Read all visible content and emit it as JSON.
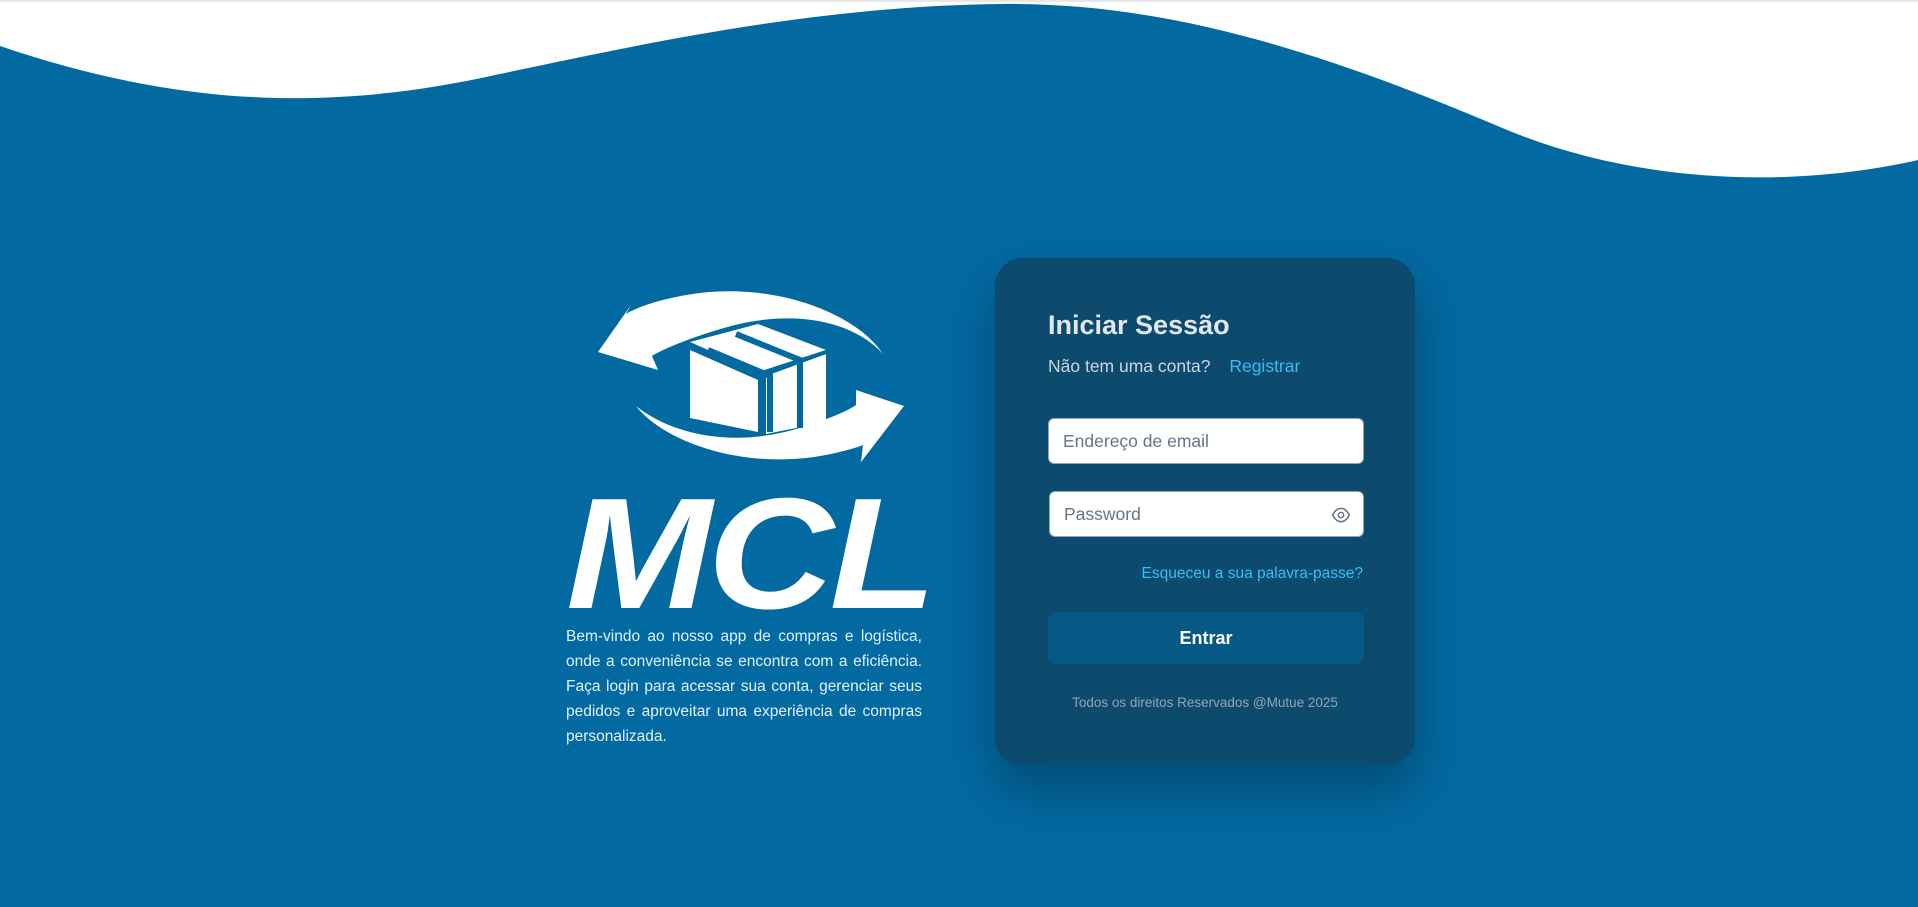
{
  "colors": {
    "background": "#0369a1",
    "card": "#0c4a6e",
    "button": "#075985",
    "link": "#38bdf8",
    "wave": "#ffffff"
  },
  "brand": {
    "logo_text": "MCL",
    "logo_icon": "box-with-circular-arrows-icon",
    "welcome_text": "Bem-vindo ao nosso app de compras e logística, onde a conveniência se encontra com a eficiência. Faça login para acessar sua conta, gerenciar seus pedidos e aproveitar uma experiência de compras personalizada."
  },
  "login": {
    "title": "Iniciar Sessão",
    "no_account_text": "Não tem uma conta?",
    "register_label": "Registrar",
    "email": {
      "placeholder": "Endereço de email",
      "value": ""
    },
    "password": {
      "placeholder": "Password",
      "value": "",
      "toggle_icon": "eye-icon"
    },
    "forgot_label": "Esqueceu a sua palavra-passe?",
    "submit_label": "Entrar",
    "footer": "Todos os direitos Reservados @Mutue 2025"
  }
}
